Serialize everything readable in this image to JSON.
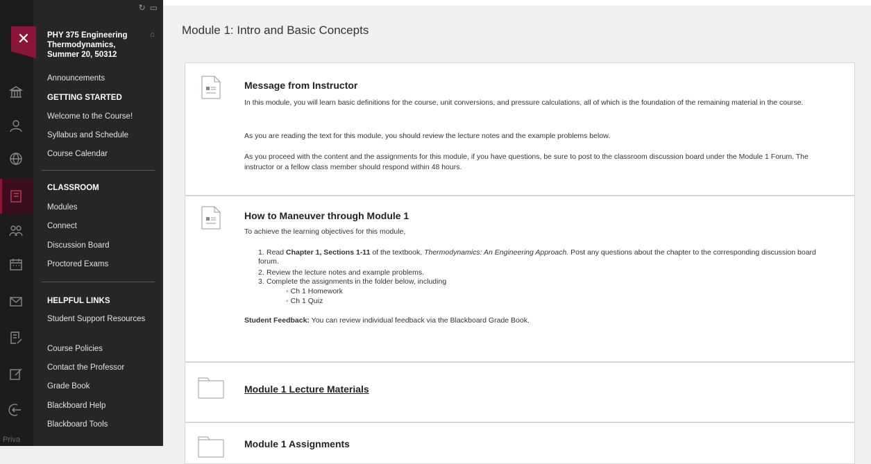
{
  "rail": {
    "icons": [
      "institution-icon",
      "user-icon",
      "globe-icon",
      "courses-icon",
      "groups-icon",
      "calendar-icon",
      "messages-icon",
      "grades-icon",
      "edit-icon",
      "sign-out-icon"
    ],
    "privacy_label": "Priva"
  },
  "course_menu": {
    "close_label": "✕",
    "course_title": "PHY 375 Engineering Thermodynamics, Summer 20, 50312",
    "items_top": [
      "Announcements"
    ],
    "getting_started": {
      "heading": "GETTING STARTED",
      "items": [
        "Welcome to the Course!",
        "Syllabus and Schedule",
        "Course Calendar"
      ]
    },
    "classroom": {
      "heading": "CLASSROOM",
      "items": [
        "Modules",
        "Connect",
        "Discussion Board",
        "Proctored Exams"
      ]
    },
    "helpful_links": {
      "heading": "HELPFUL LINKS",
      "items": [
        "Student Support Resources",
        "Course Policies",
        "Contact the Professor",
        "Grade Book",
        "Blackboard Help",
        "Blackboard Tools"
      ]
    }
  },
  "main": {
    "page_title": "Module 1: Intro and Basic Concepts",
    "message": {
      "title": "Message from Instructor",
      "paragraphs": [
        "In this module, you will learn basic definitions for the course, unit conversions, and pressure calculations, all of which is the foundation of the remaining material in the course.",
        "As you are reading the text for this module, you should review the lecture notes and the example problems below.",
        "As you proceed with the content and the assignments for this module, if you have questions, be sure to post to the classroom discussion board under the Module 1 Forum. The instructor or a fellow class member should respond within 48 hours."
      ]
    },
    "maneuver": {
      "title": "How to Maneuver through Module 1",
      "intro": "To achieve the learning objectives for this module,",
      "step1_prefix": "Read ",
      "step1_bold": "Chapter 1, Sections 1-11",
      "step1_mid": " of the textbook, ",
      "step1_italic": "Thermodynamics: An Engineering Approach.",
      "step1_suffix": " Post any questions about the chapter to the corresponding discussion board forum.",
      "step2": "Review the lecture notes and example problems.",
      "step3": "Complete the assignments in the folder below, including",
      "subitems": [
        "Ch 1 Homework",
        "Ch 1 Quiz"
      ],
      "feedback_label": "Student Feedback:",
      "feedback_text": " You can review individual feedback via the Blackboard Grade Book."
    },
    "folders": [
      "Module 1 Lecture Materials",
      "Module 1 Assignments"
    ]
  }
}
